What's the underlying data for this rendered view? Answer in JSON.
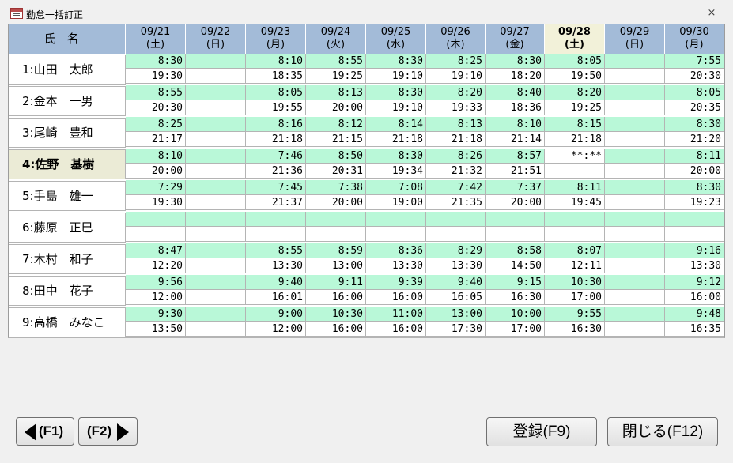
{
  "window": {
    "title": "勤怠一括訂正",
    "close_label": "×"
  },
  "grid": {
    "name_header": "氏名",
    "columns": [
      {
        "date": "09/21",
        "day": "(土)"
      },
      {
        "date": "09/22",
        "day": "(日)"
      },
      {
        "date": "09/23",
        "day": "(月)"
      },
      {
        "date": "09/24",
        "day": "(火)"
      },
      {
        "date": "09/25",
        "day": "(水)"
      },
      {
        "date": "09/26",
        "day": "(木)"
      },
      {
        "date": "09/27",
        "day": "(金)"
      },
      {
        "date": "09/28",
        "day": "(土)",
        "selected": true
      },
      {
        "date": "09/29",
        "day": "(日)"
      },
      {
        "date": "09/30",
        "day": "(月)"
      }
    ],
    "rows": [
      {
        "name": "1:山田　太郎",
        "start": [
          "8:30",
          "",
          "8:10",
          "8:55",
          "8:30",
          "8:25",
          "8:30",
          "8:05",
          "",
          "7:55"
        ],
        "end": [
          "19:30",
          "",
          "18:35",
          "19:25",
          "19:10",
          "19:10",
          "18:20",
          "19:50",
          "",
          "20:30"
        ]
      },
      {
        "name": "2:金本　一男",
        "start": [
          "8:55",
          "",
          "8:05",
          "8:13",
          "8:30",
          "8:20",
          "8:40",
          "8:20",
          "",
          "8:05"
        ],
        "end": [
          "20:30",
          "",
          "19:55",
          "20:00",
          "19:10",
          "19:33",
          "18:36",
          "19:25",
          "",
          "20:35"
        ]
      },
      {
        "name": "3:尾崎　豊和",
        "start": [
          "8:25",
          "",
          "8:16",
          "8:12",
          "8:14",
          "8:13",
          "8:10",
          "8:15",
          "",
          "8:30"
        ],
        "end": [
          "21:17",
          "",
          "21:18",
          "21:15",
          "21:18",
          "21:18",
          "21:14",
          "21:18",
          "",
          "21:20"
        ]
      },
      {
        "name": "4:佐野　基樹",
        "current": true,
        "start": [
          "8:10",
          "",
          "7:46",
          "8:50",
          "8:30",
          "8:26",
          "8:57",
          "**:**",
          "",
          "8:11"
        ],
        "end": [
          "20:00",
          "",
          "21:36",
          "20:31",
          "19:34",
          "21:32",
          "21:51",
          "",
          "",
          "20:00"
        ]
      },
      {
        "name": "5:手島　雄一",
        "start": [
          "7:29",
          "",
          "7:45",
          "7:38",
          "7:08",
          "7:42",
          "7:37",
          "8:11",
          "",
          "8:30"
        ],
        "end": [
          "19:30",
          "",
          "21:37",
          "20:00",
          "19:00",
          "21:35",
          "20:00",
          "19:45",
          "",
          "19:23"
        ]
      },
      {
        "name": "6:藤原　正巳",
        "start": [
          "",
          "",
          "",
          "",
          "",
          "",
          "",
          "",
          "",
          ""
        ],
        "end": [
          "",
          "",
          "",
          "",
          "",
          "",
          "",
          "",
          "",
          ""
        ]
      },
      {
        "name": "7:木村　和子",
        "start": [
          "8:47",
          "",
          "8:55",
          "8:59",
          "8:36",
          "8:29",
          "8:58",
          "8:07",
          "",
          "9:16"
        ],
        "end": [
          "12:20",
          "",
          "13:30",
          "13:00",
          "13:30",
          "13:30",
          "14:50",
          "12:11",
          "",
          "13:30"
        ]
      },
      {
        "name": "8:田中　花子",
        "start": [
          "9:56",
          "",
          "9:40",
          "9:11",
          "9:39",
          "9:40",
          "9:15",
          "10:30",
          "",
          "9:12"
        ],
        "end": [
          "12:00",
          "",
          "16:01",
          "16:00",
          "16:00",
          "16:05",
          "16:30",
          "17:00",
          "",
          "16:00"
        ]
      },
      {
        "name": "9:高橋　みなこ",
        "start": [
          "9:30",
          "",
          "9:00",
          "10:30",
          "11:00",
          "13:00",
          "10:00",
          "9:55",
          "",
          "9:48"
        ],
        "end": [
          "13:50",
          "",
          "12:00",
          "16:00",
          "16:00",
          "17:30",
          "17:00",
          "16:30",
          "",
          "16:35"
        ]
      }
    ]
  },
  "buttons": {
    "prev": "(F1)",
    "next": "(F2)",
    "register": "登録(F9)",
    "close": "閉じる(F12)"
  },
  "colors": {
    "header_bg": "#a3bbd8",
    "selected_header_bg": "#f2f1d9",
    "start_cell_bg": "#b9f8d8",
    "current_row_bg": "#ebebd6"
  }
}
